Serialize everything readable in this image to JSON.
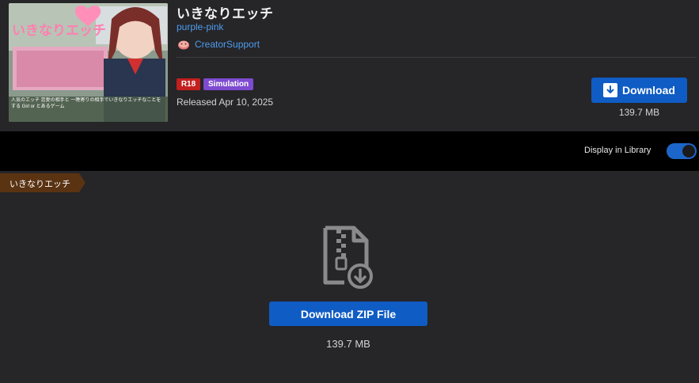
{
  "product": {
    "title": "いきなりエッチ",
    "circle": "purple-pink",
    "creator_icon": "creator-support-icon",
    "creator_link": "CreatorSupport",
    "badges": [
      {
        "label": "R18",
        "color": "#c41f1f"
      },
      {
        "label": "Simulation",
        "color": "#7d4ad0"
      }
    ],
    "released": "Released Apr 10, 2025",
    "download_label": "Download",
    "download_icon": "download-arrow-icon",
    "file_size": "139.7 MB",
    "cover_logo": "いきなりエッチ",
    "cover_tagline": "人気のエッチ 恋愛の相手と 一晩寄りの相手でいきなりエッチなことをする Girl or とあるゲーム"
  },
  "library": {
    "label": "Display in Library",
    "enabled": true
  },
  "file_section": {
    "breadcrumb": "いきなりエッチ",
    "file_icon": "zip-file-download-icon",
    "button_label": "Download ZIP File",
    "file_size": "139.7 MB"
  },
  "colors": {
    "panel": "#262527",
    "accent_blue": "#0f5cc4",
    "link": "#4d9cf0",
    "breadcrumb": "#5a3312"
  }
}
